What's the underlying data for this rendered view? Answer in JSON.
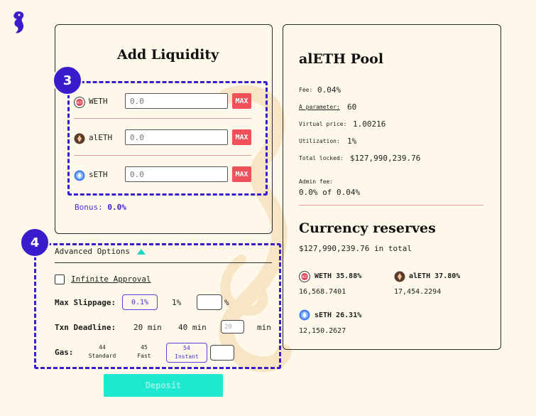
{
  "app": {
    "logo": "seahorse-logo-icon"
  },
  "colors": {
    "accent": "#3a1ccc",
    "max_button": "#f0505a",
    "deposit": "#1ee8cf",
    "separator": "#e99a99",
    "background": "#fdf8ea"
  },
  "badges": {
    "tokens": "3",
    "options": "4"
  },
  "add_liquidity": {
    "title": "Add Liquidity",
    "tokens": [
      {
        "name": "WETH",
        "icon": "weth-icon",
        "placeholder": "0.0",
        "max_label": "MAX"
      },
      {
        "name": "alETH",
        "icon": "aleth-icon",
        "placeholder": "0.0",
        "max_label": "MAX"
      },
      {
        "name": "sETH",
        "icon": "seth-icon",
        "placeholder": "0.0",
        "max_label": "MAX"
      }
    ],
    "bonus_label": "Bonus:",
    "bonus_value": "0.0%"
  },
  "advanced": {
    "label": "Advanced Options",
    "infinite_approval": "Infinite Approval",
    "max_slippage_label": "Max Slippage:",
    "slippage_options": [
      "0.1%",
      "1%"
    ],
    "slippage_unit": "%",
    "txn_deadline_label": "Txn Deadline:",
    "deadline_options": [
      "20 min",
      "40 min"
    ],
    "deadline_placeholder": "20",
    "deadline_unit": "min",
    "gas_label": "Gas:",
    "gas_options": [
      {
        "value": "44",
        "name": "Standard"
      },
      {
        "value": "45",
        "name": "Fast"
      },
      {
        "value": "54",
        "name": "Instant"
      }
    ]
  },
  "deposit_label": "Deposit",
  "pool": {
    "title": "alETH Pool",
    "fee_label": "Fee:",
    "fee_value": "0.04%",
    "a_label": "A parameter:",
    "a_value": "60",
    "virtual_label": "Virtual price:",
    "virtual_value": "1.00216",
    "util_label": "Utilization:",
    "util_value": "1%",
    "locked_label": "Total locked:",
    "locked_value": "$127,990,239.76",
    "admin_label": "Admin fee:",
    "admin_value": "0.0% of 0.04%",
    "reserves_title": "Currency reserves",
    "reserves_total": "$127,990,239.76 in total",
    "reserves": [
      {
        "name": "WETH",
        "percent": "35.88%",
        "amount": "16,568.7401",
        "icon": "weth-icon"
      },
      {
        "name": "alETH",
        "percent": "37.80%",
        "amount": "17,454.2294",
        "icon": "aleth-icon"
      },
      {
        "name": "sETH",
        "percent": "26.31%",
        "amount": "12,150.2627",
        "icon": "seth-icon"
      }
    ]
  }
}
